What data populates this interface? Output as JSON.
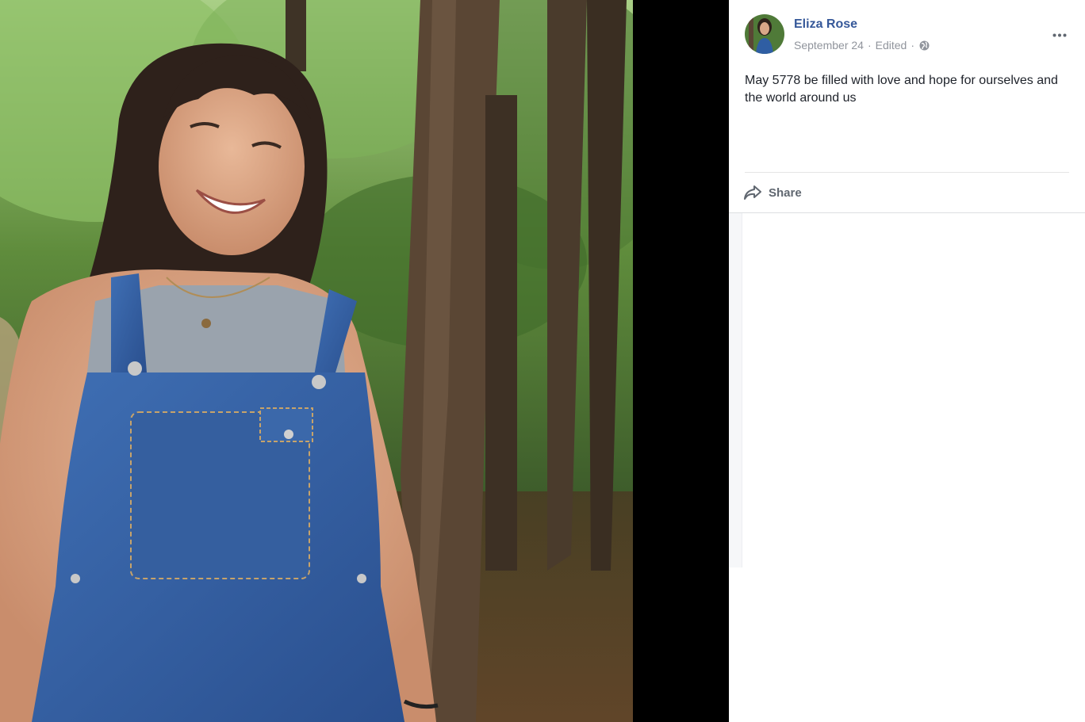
{
  "post": {
    "author": "Eliza Rose",
    "date": "September 24",
    "edited": "Edited",
    "separator": "·",
    "privacy_icon": "globe-icon",
    "text": "May 5778 be filled with love and hope for ourselves and the world around us",
    "more_icon": "more-options-icon"
  },
  "actions": {
    "share_label": "Share",
    "share_icon": "share-arrow-icon"
  },
  "colors": {
    "author_link": "#365899",
    "meta_gray": "#90949c",
    "body_text": "#1d2129",
    "action_gray": "#606770",
    "stage_background": "#000000"
  }
}
